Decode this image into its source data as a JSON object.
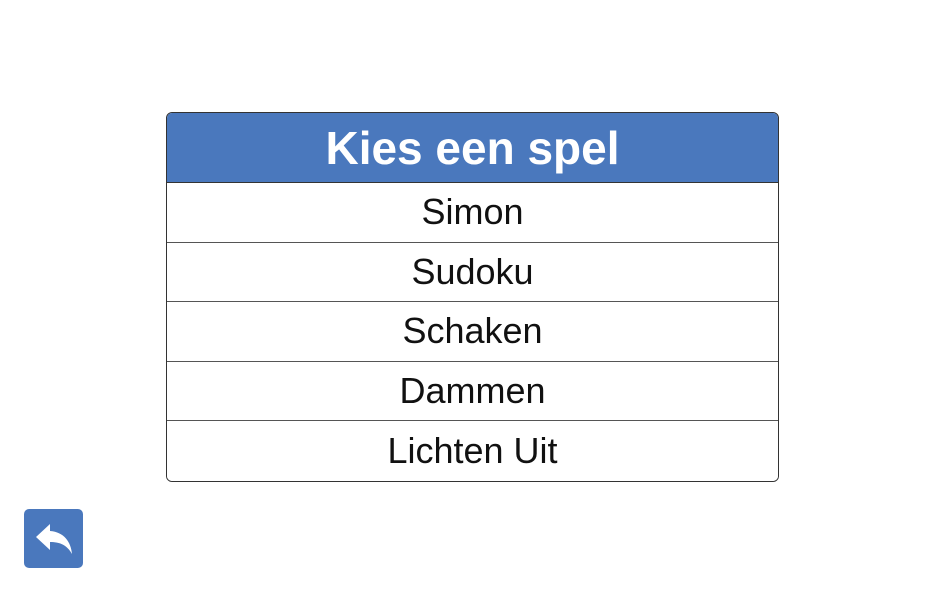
{
  "menu": {
    "title": "Kies een spel",
    "items": [
      {
        "label": "Simon"
      },
      {
        "label": "Sudoku"
      },
      {
        "label": "Schaken"
      },
      {
        "label": "Dammen"
      },
      {
        "label": "Lichten Uit"
      }
    ]
  },
  "back_button": {
    "icon": "reply-arrow-icon"
  },
  "colors": {
    "accent": "#4a78bd",
    "background": "#ffffff",
    "text": "#111111"
  }
}
